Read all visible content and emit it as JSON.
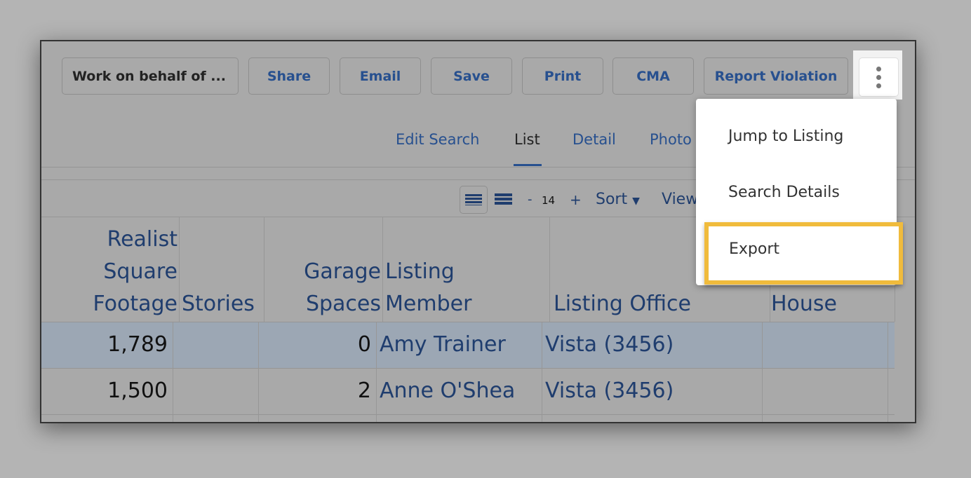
{
  "toolbar": {
    "buttons": [
      "Work on behalf of ...",
      "Share",
      "Email",
      "Save",
      "Print",
      "CMA",
      "Report Violation"
    ],
    "more_icon": "vertical-ellipsis-icon"
  },
  "tabs": [
    "Edit Search",
    "List",
    "Detail",
    "Photo"
  ],
  "active_tab": "List",
  "view_controls": {
    "minus": "-",
    "page_size": "14",
    "plus": "+",
    "sort": "Sort",
    "view": "View"
  },
  "table": {
    "headers": [
      "Realist Square Footage",
      "Stories",
      "Garage Spaces",
      "Listing Member",
      "Listing Office",
      "House"
    ],
    "header_lines": [
      [
        "Realist",
        "Square",
        "Footage"
      ],
      [
        "Stories"
      ],
      [
        "Garage",
        "Spaces"
      ],
      [
        "Listing",
        "Member"
      ],
      [
        "Listing Office"
      ],
      [
        "House"
      ]
    ],
    "rows": [
      [
        "1,789",
        "",
        "0",
        "Amy Trainer",
        "Vista (3456)",
        ""
      ],
      [
        "1,500",
        "",
        "2",
        "Anne O'Shea",
        "Vista (3456)",
        ""
      ]
    ]
  },
  "menu": {
    "items": [
      "Jump to Listing",
      "Search Details",
      "Export"
    ],
    "highlighted": "Export",
    "highlight_color": "#f0bb3c"
  }
}
